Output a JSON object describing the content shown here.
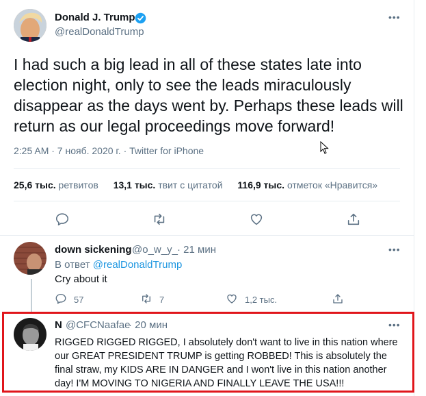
{
  "main_tweet": {
    "author_name": "Donald J. Trump",
    "author_handle": "@realDonaldTrump",
    "text": "I had such a big lead in all of these states late into election night, only to see the leads miraculously disappear as the days went by. Perhaps these leads will return as our legal proceedings move forward!",
    "meta": "2:25 AM · 7 нояб. 2020 г. · Twitter for iPhone",
    "stats": [
      {
        "count": "25,6 тыс.",
        "label": "ретвитов"
      },
      {
        "count": "13,1 тыс.",
        "label": "твит с цитатой"
      },
      {
        "count": "116,9 тыс.",
        "label": "отметок «Нравится»"
      }
    ]
  },
  "reply1": {
    "author_name": "down sickening",
    "author_handle": "@o_w_y_",
    "time": "· 21 мин",
    "reply_prefix": "В ответ",
    "reply_to": "@realDonaldTrump",
    "text": "Cry about it",
    "reply_count": "57",
    "retweet_count": "7",
    "like_count": "1,2 тыс."
  },
  "reply2": {
    "author_name": "N",
    "author_handle": "@CFCNaafae",
    "time": "· 20 мин",
    "text": "RIGGED RIGGED RIGGED, I absolutely don't want to live in this nation where our GREAT PRESIDENT TRUMP is getting ROBBED! This is absolutely the final straw, my KIDS ARE IN DANGER and I won't live in this nation another day! I'M MOVING TO NIGERIA AND FINALLY LEAVE THE USA!!!"
  },
  "icons": {
    "more": "more-icon",
    "verified": "verified-badge-icon",
    "reply": "reply-icon",
    "retweet": "retweet-icon",
    "like": "like-icon",
    "share": "share-icon"
  },
  "colors": {
    "accent": "#1da1f2",
    "muted": "#5b7083",
    "highlight_border": "#e0151b"
  }
}
